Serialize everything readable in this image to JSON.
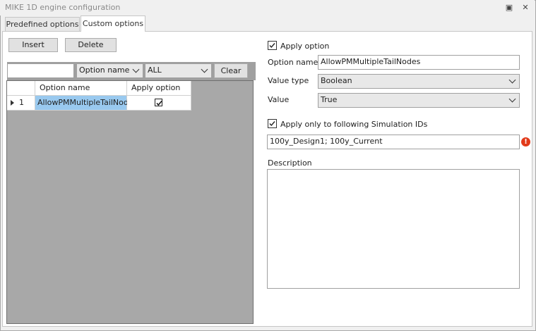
{
  "window": {
    "title": "MIKE 1D engine configuration",
    "restore_glyph": "▣",
    "close_glyph": "✕"
  },
  "tabs": [
    {
      "label": "Predefined options"
    },
    {
      "label": "Custom options"
    }
  ],
  "toolbar": {
    "insert_label": "Insert",
    "delete_label": "Delete"
  },
  "filter": {
    "search_value": "",
    "field_value": "Option name",
    "scope_value": "ALL",
    "clear_label": "Clear"
  },
  "grid": {
    "columns": [
      "Option name",
      "Apply option"
    ],
    "rows": [
      {
        "index": "1",
        "option_name": "AllowPMMultipleTailNodes",
        "apply": "true"
      }
    ]
  },
  "details": {
    "apply_option_label": "Apply option",
    "apply_option_checked": "true",
    "option_name_label": "Option name",
    "option_name_value": "AllowPMMultipleTailNodes",
    "value_type_label": "Value type",
    "value_type_value": "Boolean",
    "value_label": "Value",
    "value_value": "True",
    "apply_only_label": "Apply only to following Simulation IDs",
    "apply_only_checked": "true",
    "simulation_ids_value": "100y_Design1; 100y_Current",
    "error_glyph": "!",
    "description_label": "Description",
    "description_value": ""
  },
  "colors": {
    "selection": "#99c9ef",
    "error": "#e23a1a",
    "grid_bg": "#a8a8a8"
  }
}
